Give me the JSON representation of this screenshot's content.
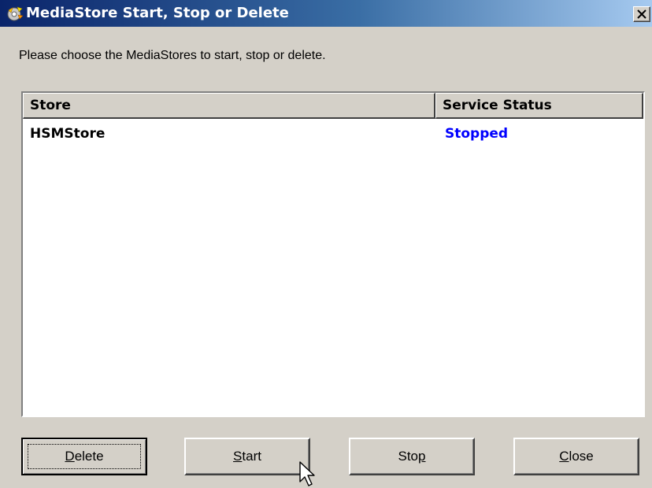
{
  "window": {
    "title": "MediaStore Start, Stop or Delete",
    "icon": "mediastore-app-icon",
    "close_icon": "close-x-icon"
  },
  "instructions": "Please choose the MediaStores to start, stop or delete.",
  "list": {
    "columns": [
      "Store",
      "Service Status"
    ],
    "rows": [
      {
        "store": "HSMStore",
        "status": "Stopped",
        "status_color": "#0000ff"
      }
    ]
  },
  "buttons": {
    "delete": {
      "label": "Delete",
      "mnemonic": "D"
    },
    "start": {
      "label": "Start",
      "mnemonic": "S"
    },
    "stop": {
      "label": "Stop",
      "mnemonic": "p"
    },
    "close": {
      "label": "Close",
      "mnemonic": "C"
    }
  },
  "colors": {
    "titlebar_start": "#0a246a",
    "titlebar_end": "#a6caf0",
    "face": "#d4d0c8",
    "status_stopped": "#0000ff"
  }
}
